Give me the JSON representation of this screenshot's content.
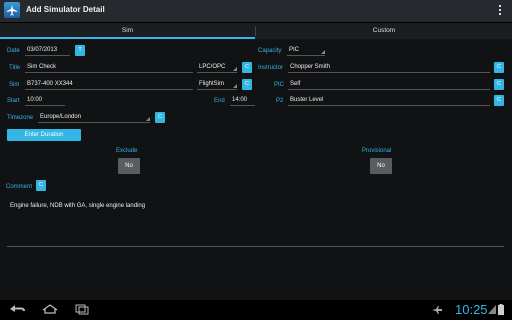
{
  "app": {
    "title": "Add Simulator Detail"
  },
  "tabs": [
    {
      "label": "Sim"
    },
    {
      "label": "Custom"
    }
  ],
  "form": {
    "date": {
      "label": "Date",
      "value": "03/07/2013",
      "button": "T"
    },
    "capacity": {
      "label": "Capacity",
      "value": "PIC"
    },
    "title": {
      "label": "Title",
      "value": "Sim Check",
      "type_value": "LPC/OPC",
      "button": "C"
    },
    "instructor": {
      "label": "Instructor",
      "value": "Chopper Smith",
      "button": "C"
    },
    "sim": {
      "label": "Sim",
      "value": "B737-400 XX344",
      "type_value": "FlightSim",
      "button": "C"
    },
    "pic": {
      "label": "PIC",
      "value": "Self",
      "button": "C"
    },
    "start": {
      "label": "Start",
      "value": "10:00"
    },
    "end": {
      "label": "End",
      "value": "14:00"
    },
    "p2": {
      "label": "P2",
      "value": "Buster Level",
      "button": "C"
    },
    "timezone": {
      "label": "Timezone",
      "value": "Europe/London",
      "button": "C"
    },
    "enter_duration": "Enter Duration",
    "exclude": {
      "label": "Exclude",
      "value": "No"
    },
    "provisional": {
      "label": "Provisional",
      "value": "No"
    },
    "comment": {
      "label": "Comment",
      "button": "C",
      "value": "Engine failure, NDB with GA, single engine landing"
    }
  },
  "status": {
    "time": "10:25"
  },
  "colors": {
    "accent": "#33b5e5",
    "background": "#101214"
  }
}
